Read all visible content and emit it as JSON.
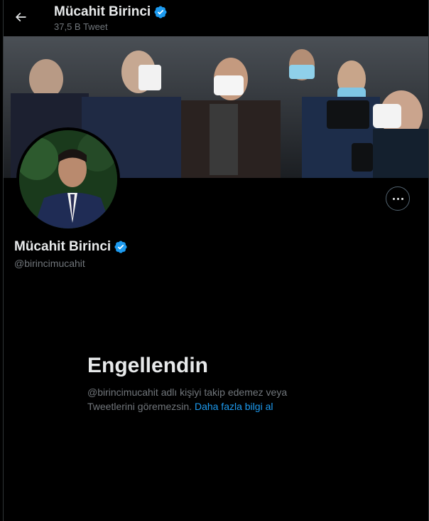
{
  "header": {
    "name": "Mücahit Birinci",
    "tweet_count": "37,5 B Tweet"
  },
  "profile": {
    "name": "Mücahit Birinci",
    "handle": "@birincimucahit"
  },
  "blocked": {
    "title": "Engellendin",
    "text": "@birincimucahit adlı kişiyi takip edemez veya Tweetlerini göremezsin.",
    "link": "Daha fazla bilgi al"
  },
  "colors": {
    "background": "#000000",
    "accent": "#1d9bf0",
    "secondary_text": "#71767b",
    "primary_text": "#e7e9ea"
  },
  "icons": {
    "back": "arrow-left-icon",
    "verified": "verified-badge-icon",
    "more": "more-horizontal-icon"
  }
}
